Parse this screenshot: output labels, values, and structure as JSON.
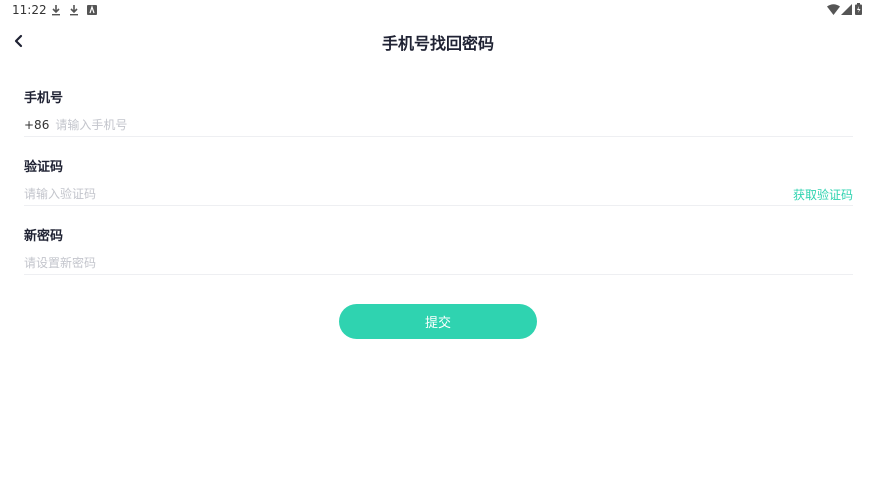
{
  "status_bar": {
    "time": "11:22",
    "left_icons": [
      "download-icon",
      "download-icon",
      "app-notification-icon"
    ],
    "right_icons": [
      "wifi-icon",
      "signal-icon",
      "battery-icon"
    ]
  },
  "header": {
    "back_icon": "chevron-left-icon",
    "title": "手机号找回密码"
  },
  "form": {
    "phone": {
      "label": "手机号",
      "prefix": "+86",
      "placeholder": "请输入手机号",
      "value": ""
    },
    "code": {
      "label": "验证码",
      "placeholder": "请输入验证码",
      "value": "",
      "get_code_label": "获取验证码"
    },
    "new_password": {
      "label": "新密码",
      "placeholder": "请设置新密码",
      "value": ""
    }
  },
  "submit_label": "提交",
  "colors": {
    "accent": "#2fd3b0",
    "title_text": "#1f2233",
    "placeholder": "#c3c5cc",
    "divider": "#eeeff2"
  }
}
